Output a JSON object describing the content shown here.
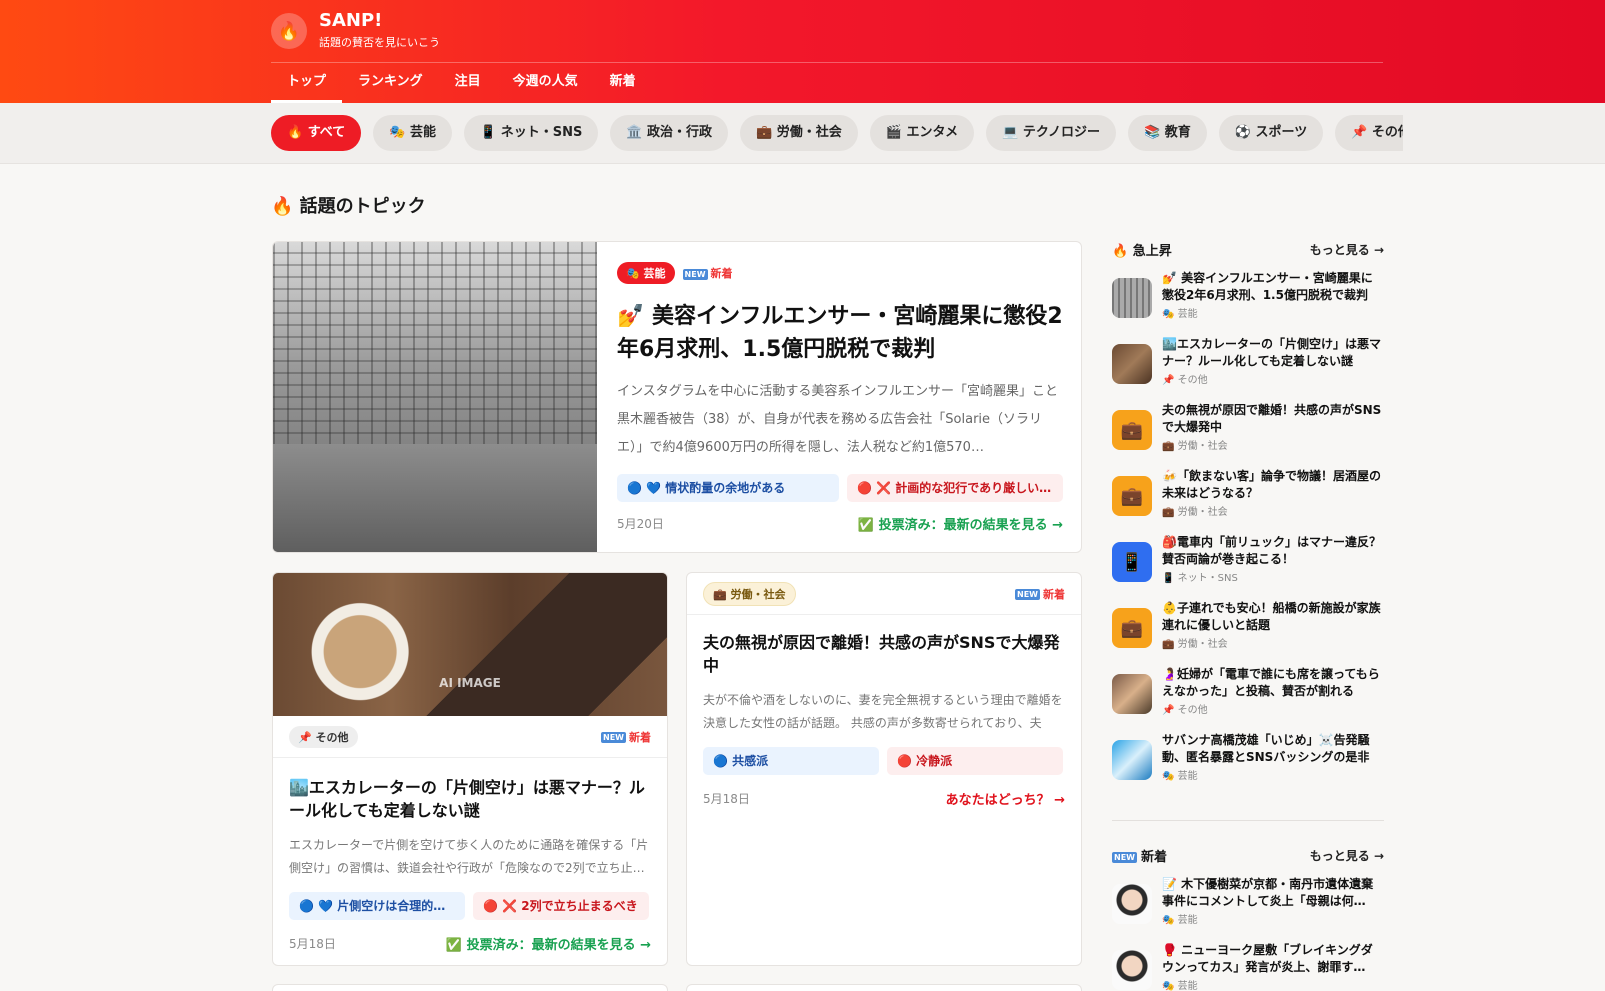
{
  "header": {
    "brand": "SANP!",
    "tagline": "話題の賛否を見にいこう",
    "logo_icon": "🔥",
    "nav": [
      {
        "label": "トップ",
        "active": true
      },
      {
        "label": "ランキング"
      },
      {
        "label": "注目"
      },
      {
        "label": "今週の人気"
      },
      {
        "label": "新着"
      }
    ]
  },
  "categories": [
    {
      "label": "🔥 すべて",
      "active": true
    },
    {
      "label": "🎭 芸能"
    },
    {
      "label": "📱 ネット・SNS"
    },
    {
      "label": "🏛️ 政治・行政"
    },
    {
      "label": "💼 労働・社会"
    },
    {
      "label": "🎬 エンタメ"
    },
    {
      "label": "💻 テクノロジー"
    },
    {
      "label": "📚 教育"
    },
    {
      "label": "⚽ スポーツ"
    },
    {
      "label": "📌 その他"
    }
  ],
  "section_title": "🔥 話題のトピック",
  "featured": {
    "category": "🎭 芸能",
    "new_label": "新着",
    "new_icon": "NEW",
    "title": "💅 美容インフルエンサー・宮崎麗果に懲役2年6月求刑、1.5億円脱税で裁判",
    "description": "インスタグラムを中心に活動する美容系インフルエンサー「宮崎麗果」こと黒木麗香被告（38）が、自身が代表を務める広告会社「Solarie（ソラリエ）」で約4億9600万円の所得を隠し、法人税など約1億570…",
    "vote_a": "🔵 💙 情状酌量の余地がある",
    "vote_b": "🔴 ❌ 計画的な犯行であり厳しい…",
    "date": "5月20日",
    "cta": "✅ 投票済み：最新の結果を見る →"
  },
  "card2": {
    "image_label": "AI IMAGE",
    "category": "📌 その他",
    "new_label": "新着",
    "new_icon": "NEW",
    "title": "🏙️エスカレーターの「片側空け」は悪マナー？ルール化しても定着しない謎",
    "description": "エスカレーターで片側を空けて歩く人のために通路を確保する「片側空け」の習慣は、鉄道会社や行政が「危険なので2列で立ち止…",
    "vote_a": "🔵 💙 片側空けは合理的な…",
    "vote_b": "🔴 ❌ 2列で立ち止まるべき",
    "date": "5月18日",
    "cta": "✅ 投票済み：最新の結果を見る →"
  },
  "card3": {
    "category": "💼 労働・社会",
    "new_label": "新着",
    "new_icon": "NEW",
    "title": "夫の無視が原因で離婚！共感の声がSNSで大爆発中",
    "description": "夫が不倫や酒をしないのに、妻を完全無視するという理由で離婚を決意した女性の話が話題。 共感の声が多数寄せられており、夫婦…",
    "vote_a": "🔵 共感派",
    "vote_b": "🔴 冷静派",
    "date": "5月18日",
    "cta": "あなたはどっち？ →"
  },
  "sidebar": {
    "rising": {
      "title": "🔥 急上昇",
      "more": "もっと見る →",
      "items": [
        {
          "title": "💅 美容インフルエンサー・宮崎麗果に懲役2年6月求刑、1.5億円脱税で裁判",
          "cat": "🎭 芸能",
          "thumb": "photo-grey",
          "icon": ""
        },
        {
          "title": "🏙️エスカレーターの「片側空け」は悪マナー？ルール化しても定着しない謎",
          "cat": "📌 その他",
          "thumb": "photo-brown",
          "icon": ""
        },
        {
          "title": "夫の無視が原因で離婚！共感の声がSNSで大爆発中",
          "cat": "💼 労働・社会",
          "thumb": "orange",
          "icon": "💼"
        },
        {
          "title": "🍻「飲まない客」論争で物議！居酒屋の未来はどうなる？",
          "cat": "💼 労働・社会",
          "thumb": "orange",
          "icon": "💼"
        },
        {
          "title": "🎒電車内「前リュック」はマナー違反？ 賛否両論が巻き起こる！",
          "cat": "📱 ネット・SNS",
          "thumb": "blue",
          "icon": "📱"
        },
        {
          "title": "👶子連れでも安心！船橋の新施設が家族連れに優しいと話題",
          "cat": "💼 労働・社会",
          "thumb": "orange",
          "icon": "💼"
        },
        {
          "title": "🤰妊婦が「電車で誰にも席を譲ってもらえなかった」と投稿、賛否が割れる",
          "cat": "📌 その他",
          "thumb": "photo-people",
          "icon": ""
        },
        {
          "title": "サバンナ高橋茂雄「いじめ」☠️告発騒動、匿名暴露とSNSバッシングの是非",
          "cat": "🎭 芸能",
          "thumb": "photo-cyan",
          "icon": ""
        }
      ]
    },
    "newest": {
      "title": "新着",
      "new_icon": "NEW",
      "more": "もっと見る →",
      "items": [
        {
          "title": "📝 木下優樹菜が京都・南丹市遺体遺棄事件にコメントして炎上「母親は何…",
          "cat": "🎭 芸能",
          "thumb": "photo-portrait",
          "icon": ""
        },
        {
          "title": "🥊 ニューヨーク屋敷「ブレイキングダウンってカス」発言が炎上、謝罪す…",
          "cat": "🎭 芸能",
          "thumb": "photo-portrait",
          "icon": ""
        }
      ]
    }
  }
}
